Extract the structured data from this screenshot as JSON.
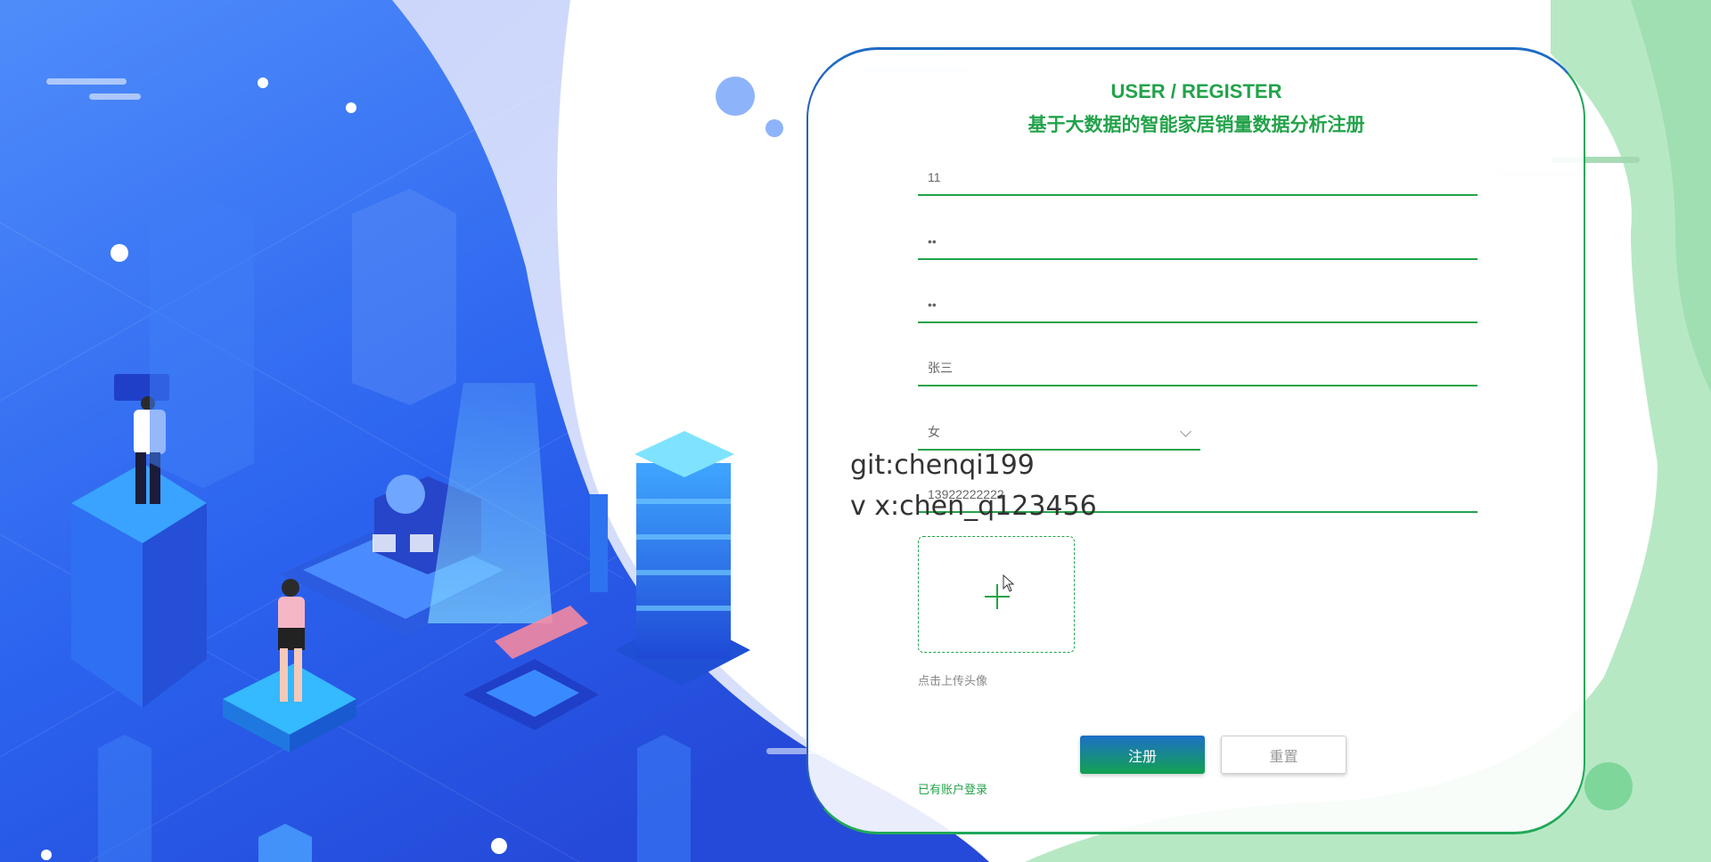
{
  "form": {
    "title_en": "USER / REGISTER",
    "title_cn": "基于大数据的智能家居销量数据分析注册",
    "fields": [
      {
        "value": "11"
      },
      {
        "value": "••",
        "type": "password"
      },
      {
        "value": "••",
        "type": "password"
      },
      {
        "value": "张三"
      },
      {
        "value": "13922222222"
      }
    ],
    "gender": {
      "selected": "女"
    },
    "upload_hint": "点击上传头像",
    "register_label": "注册",
    "reset_label": "重置",
    "login_link": "已有账户登录"
  },
  "watermark": {
    "line1": "git:chenqi199",
    "line2": "v x:chen_q123456"
  },
  "colors": {
    "accent_green": "#22a34a",
    "accent_blue": "#1d6fc7"
  },
  "icons": {
    "upload": "plus-icon",
    "select_arrow": "chevron-down-icon",
    "pointer": "mouse-cursor-icon"
  }
}
